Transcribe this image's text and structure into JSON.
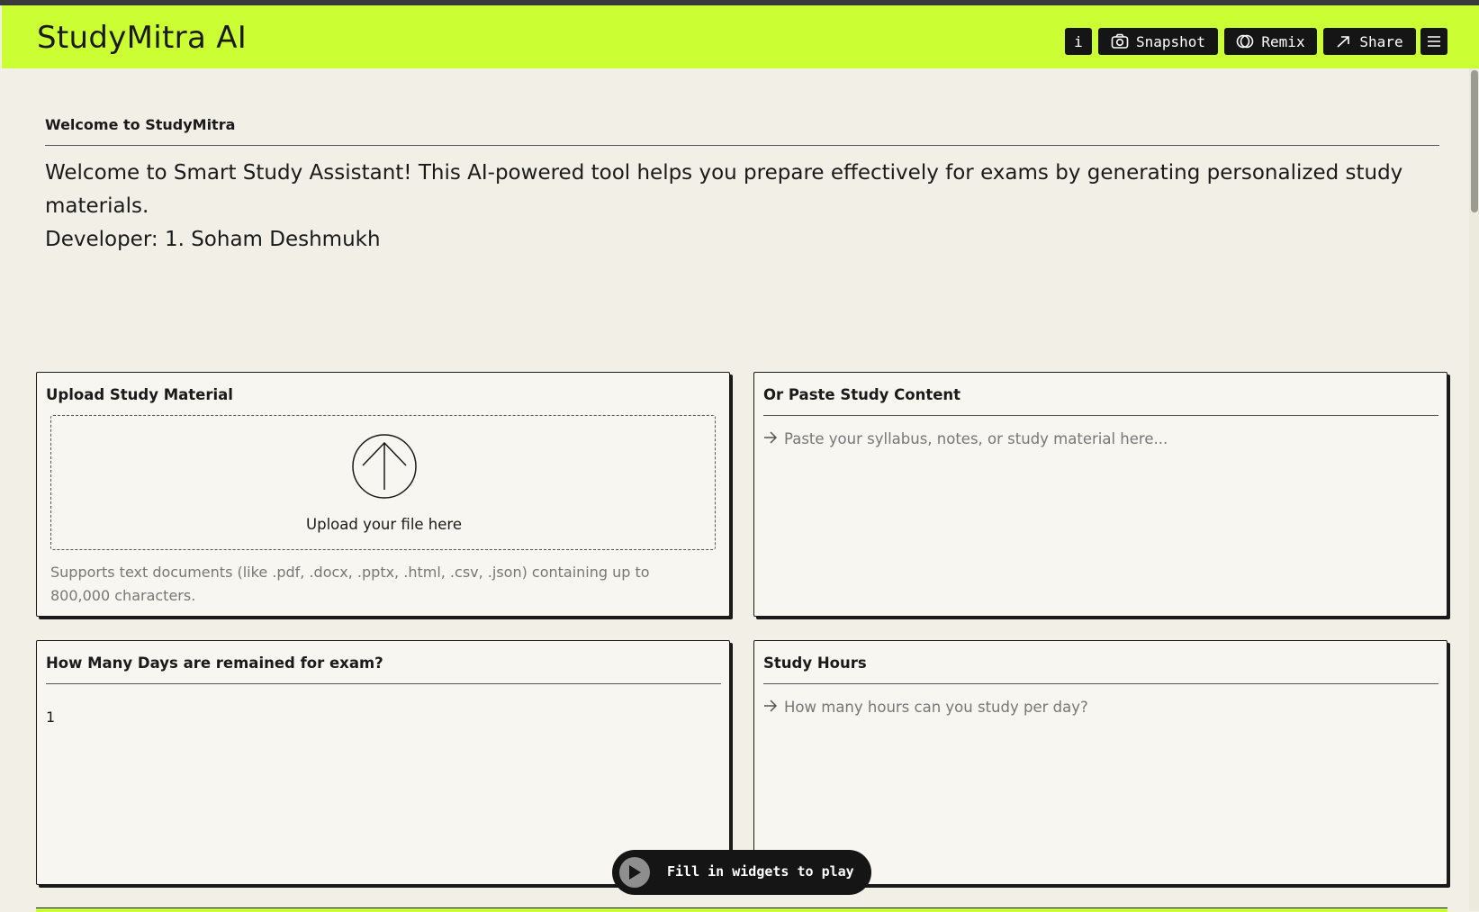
{
  "app": {
    "title": "StudyMitra AI",
    "accent_color": "#ccff33"
  },
  "header": {
    "info_label": "i",
    "snapshot_label": "Snapshot",
    "remix_label": "Remix",
    "share_label": "Share",
    "icons": {
      "snapshot": "camera-icon",
      "remix": "remix-icon",
      "share": "share-arrow-icon",
      "menu": "hamburger-menu-icon"
    }
  },
  "welcome": {
    "heading": "Welcome to StudyMitra",
    "text_line1": "Welcome to Smart Study Assistant! This AI-powered tool helps you prepare effectively for exams by generating personalized study materials.",
    "text_line2": "Developer: 1. Soham Deshmukh"
  },
  "upload_panel": {
    "title": "Upload Study Material",
    "drop_label": "Upload your file here",
    "note": "Supports text documents (like .pdf, .docx, .pptx, .html, .csv, .json) containing up to 800,000 characters.",
    "icon": "upload-arrow-icon"
  },
  "paste_panel": {
    "title": "Or Paste Study Content",
    "placeholder": "Paste your syllabus, notes, or study material here..."
  },
  "days_panel": {
    "title": "How Many Days are remained for exam?",
    "value": "1"
  },
  "hours_panel": {
    "title": "Study Hours",
    "placeholder": "How many hours can you study per day?"
  },
  "play_pill": {
    "label": "Fill in widgets to play",
    "icon": "play-icon"
  }
}
